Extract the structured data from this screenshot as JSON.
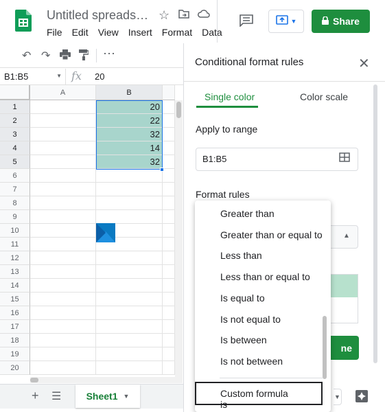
{
  "app": {
    "doc_title": "Untitled spreads…",
    "menu": [
      "File",
      "Edit",
      "View",
      "Insert",
      "Format",
      "Data"
    ],
    "share_label": "Share",
    "colors": {
      "brand_green": "#1e8e3e",
      "selection": "#a8d5cc",
      "preview_fill": "#b7e1cd"
    }
  },
  "formula_bar": {
    "name_box": "B1:B5",
    "fx": "fx",
    "value": "20"
  },
  "grid": {
    "columns": [
      "A",
      "B"
    ],
    "rows": [
      "1",
      "2",
      "3",
      "4",
      "5",
      "6",
      "7",
      "8",
      "9",
      "10",
      "11",
      "12",
      "13",
      "14",
      "15",
      "16",
      "17",
      "18",
      "19",
      "20"
    ],
    "b_values": [
      "20",
      "22",
      "32",
      "14",
      "32"
    ]
  },
  "sheet_tabs": {
    "active": "Sheet1"
  },
  "panel": {
    "title": "Conditional format rules",
    "tabs": [
      "Single color",
      "Color scale"
    ],
    "apply_label": "Apply to range",
    "range_value": "B1:B5",
    "rules_label": "Format rules",
    "done_label": "ne"
  },
  "dropdown": {
    "items": [
      "Greater than",
      "Greater than or equal to",
      "Less than",
      "Less than or equal to",
      "Is equal to",
      "Is not equal to",
      "Is between",
      "Is not between"
    ],
    "highlighted": "Custom formula is"
  },
  "icons": [
    "sheets-logo-icon",
    "star-icon",
    "move-folder-icon",
    "cloud-status-icon",
    "comments-icon",
    "present-icon",
    "lock-icon",
    "undo-icon",
    "redo-icon",
    "print-icon",
    "paint-format-icon",
    "more-icon",
    "grid-range-icon",
    "close-icon",
    "add-sheet-icon",
    "all-sheets-icon",
    "explore-icon"
  ]
}
